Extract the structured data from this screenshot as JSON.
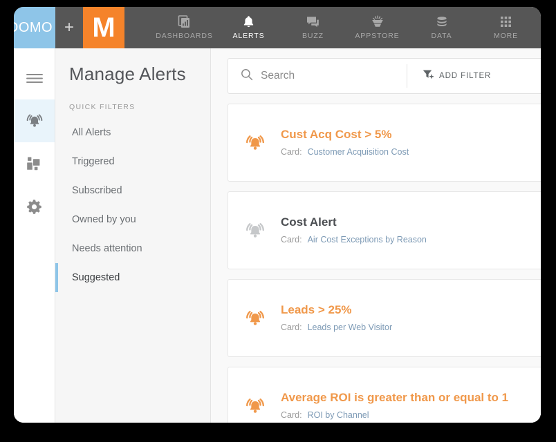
{
  "brand": {
    "domo_logo_text": "DOMO",
    "plus_symbol": "+",
    "partner_logo_text": "M",
    "domo_color": "#8ec5e8",
    "partner_color": "#f5832a",
    "topbar_color": "#565656"
  },
  "topnav": {
    "items": [
      {
        "label": "DASHBOARDS",
        "icon": "dashboard-chart-icon",
        "active": false
      },
      {
        "label": "ALERTS",
        "icon": "bell-icon",
        "active": true
      },
      {
        "label": "BUZZ",
        "icon": "chat-bubbles-icon",
        "active": false
      },
      {
        "label": "APPSTORE",
        "icon": "appstore-icon",
        "active": false
      },
      {
        "label": "DATA",
        "icon": "database-icon",
        "active": false
      },
      {
        "label": "MORE",
        "icon": "grid-dots-icon",
        "active": false
      }
    ]
  },
  "rail": {
    "items": [
      {
        "icon": "hamburger-menu-icon",
        "name": "menu",
        "active": false
      },
      {
        "icon": "alert-bell-ringing-icon",
        "name": "alerts",
        "active": true
      },
      {
        "icon": "cards-blocks-icon",
        "name": "cards",
        "active": false
      },
      {
        "icon": "gear-icon",
        "name": "settings",
        "active": false
      }
    ]
  },
  "sidebar": {
    "title": "Manage Alerts",
    "quick_filters_label": "QUICK FILTERS",
    "items": [
      {
        "label": "All Alerts",
        "selected": false
      },
      {
        "label": "Triggered",
        "selected": false
      },
      {
        "label": "Subscribed",
        "selected": false
      },
      {
        "label": "Owned by you",
        "selected": false
      },
      {
        "label": "Needs attention",
        "selected": false
      },
      {
        "label": "Suggested",
        "selected": true
      }
    ],
    "selected_accent": "#8ec5e8"
  },
  "search": {
    "placeholder": "Search",
    "value": "",
    "icon": "search-icon",
    "add_filter_label": "ADD FILTER",
    "add_filter_icon": "funnel-plus-icon"
  },
  "alerts": {
    "card_label": "Card:",
    "triggered_color": "#f0984a",
    "normal_color": "#4b4e52",
    "link_color": "#7d9ab5",
    "items": [
      {
        "title": "Cust Acq Cost > 5%",
        "card_label": "Card:",
        "card_name": "Customer Acquisition Cost",
        "state": "triggered"
      },
      {
        "title": "Cost Alert",
        "card_label": "Card:",
        "card_name": "Air Cost Exceptions by Reason",
        "state": "normal"
      },
      {
        "title": "Leads > 25%",
        "card_label": "Card:",
        "card_name": "Leads per Web Visitor",
        "state": "triggered"
      },
      {
        "title": "Average ROI is greater than or equal to 1",
        "card_label": "Card:",
        "card_name": "ROI by Channel",
        "state": "triggered"
      }
    ]
  }
}
